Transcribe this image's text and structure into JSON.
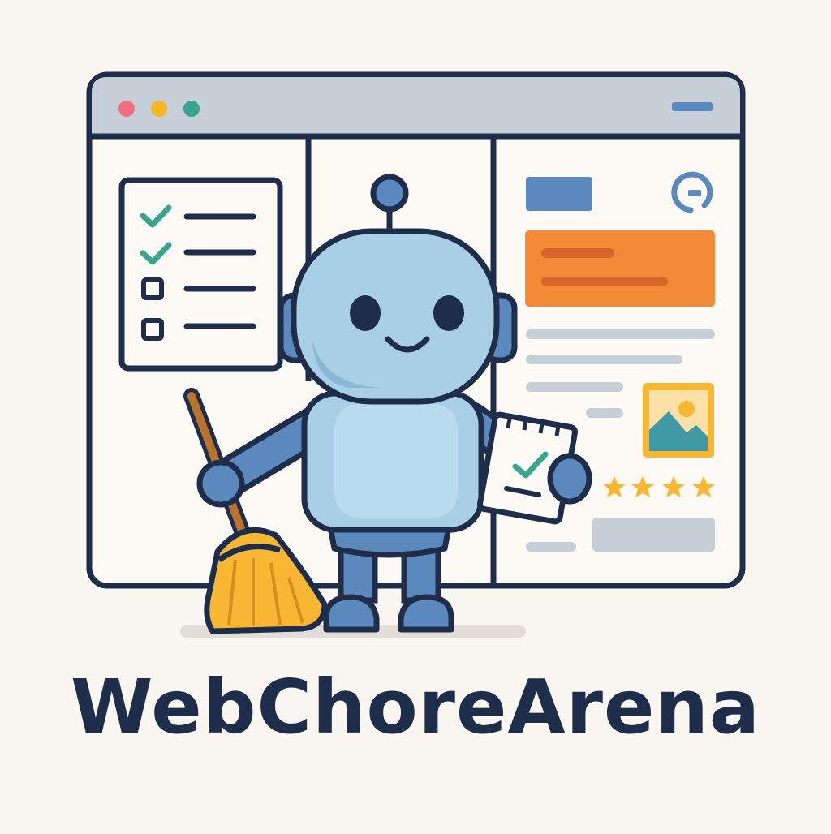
{
  "logo": {
    "title": "WebChoreArena"
  },
  "colors": {
    "background": "#faf6f1",
    "outline": "#1e2d4a",
    "robot_light": "#a9cfe6",
    "robot_dark": "#5b88bd",
    "accent_orange": "#f48a35",
    "broom_yellow": "#f7b733",
    "check_teal": "#3aa58f"
  },
  "icons": {
    "window_controls": [
      "close-dot",
      "minimize-dot",
      "maximize-dot"
    ],
    "robot": "robot-mascot",
    "broom": "broom-icon",
    "checklist": "checklist-icon",
    "notepad": "notepad-check-icon",
    "image": "image-placeholder-icon",
    "refresh": "refresh-icon",
    "stars": "star-icon"
  },
  "rating": {
    "stars": 4
  },
  "checklist": {
    "checked": 2,
    "total": 4
  }
}
